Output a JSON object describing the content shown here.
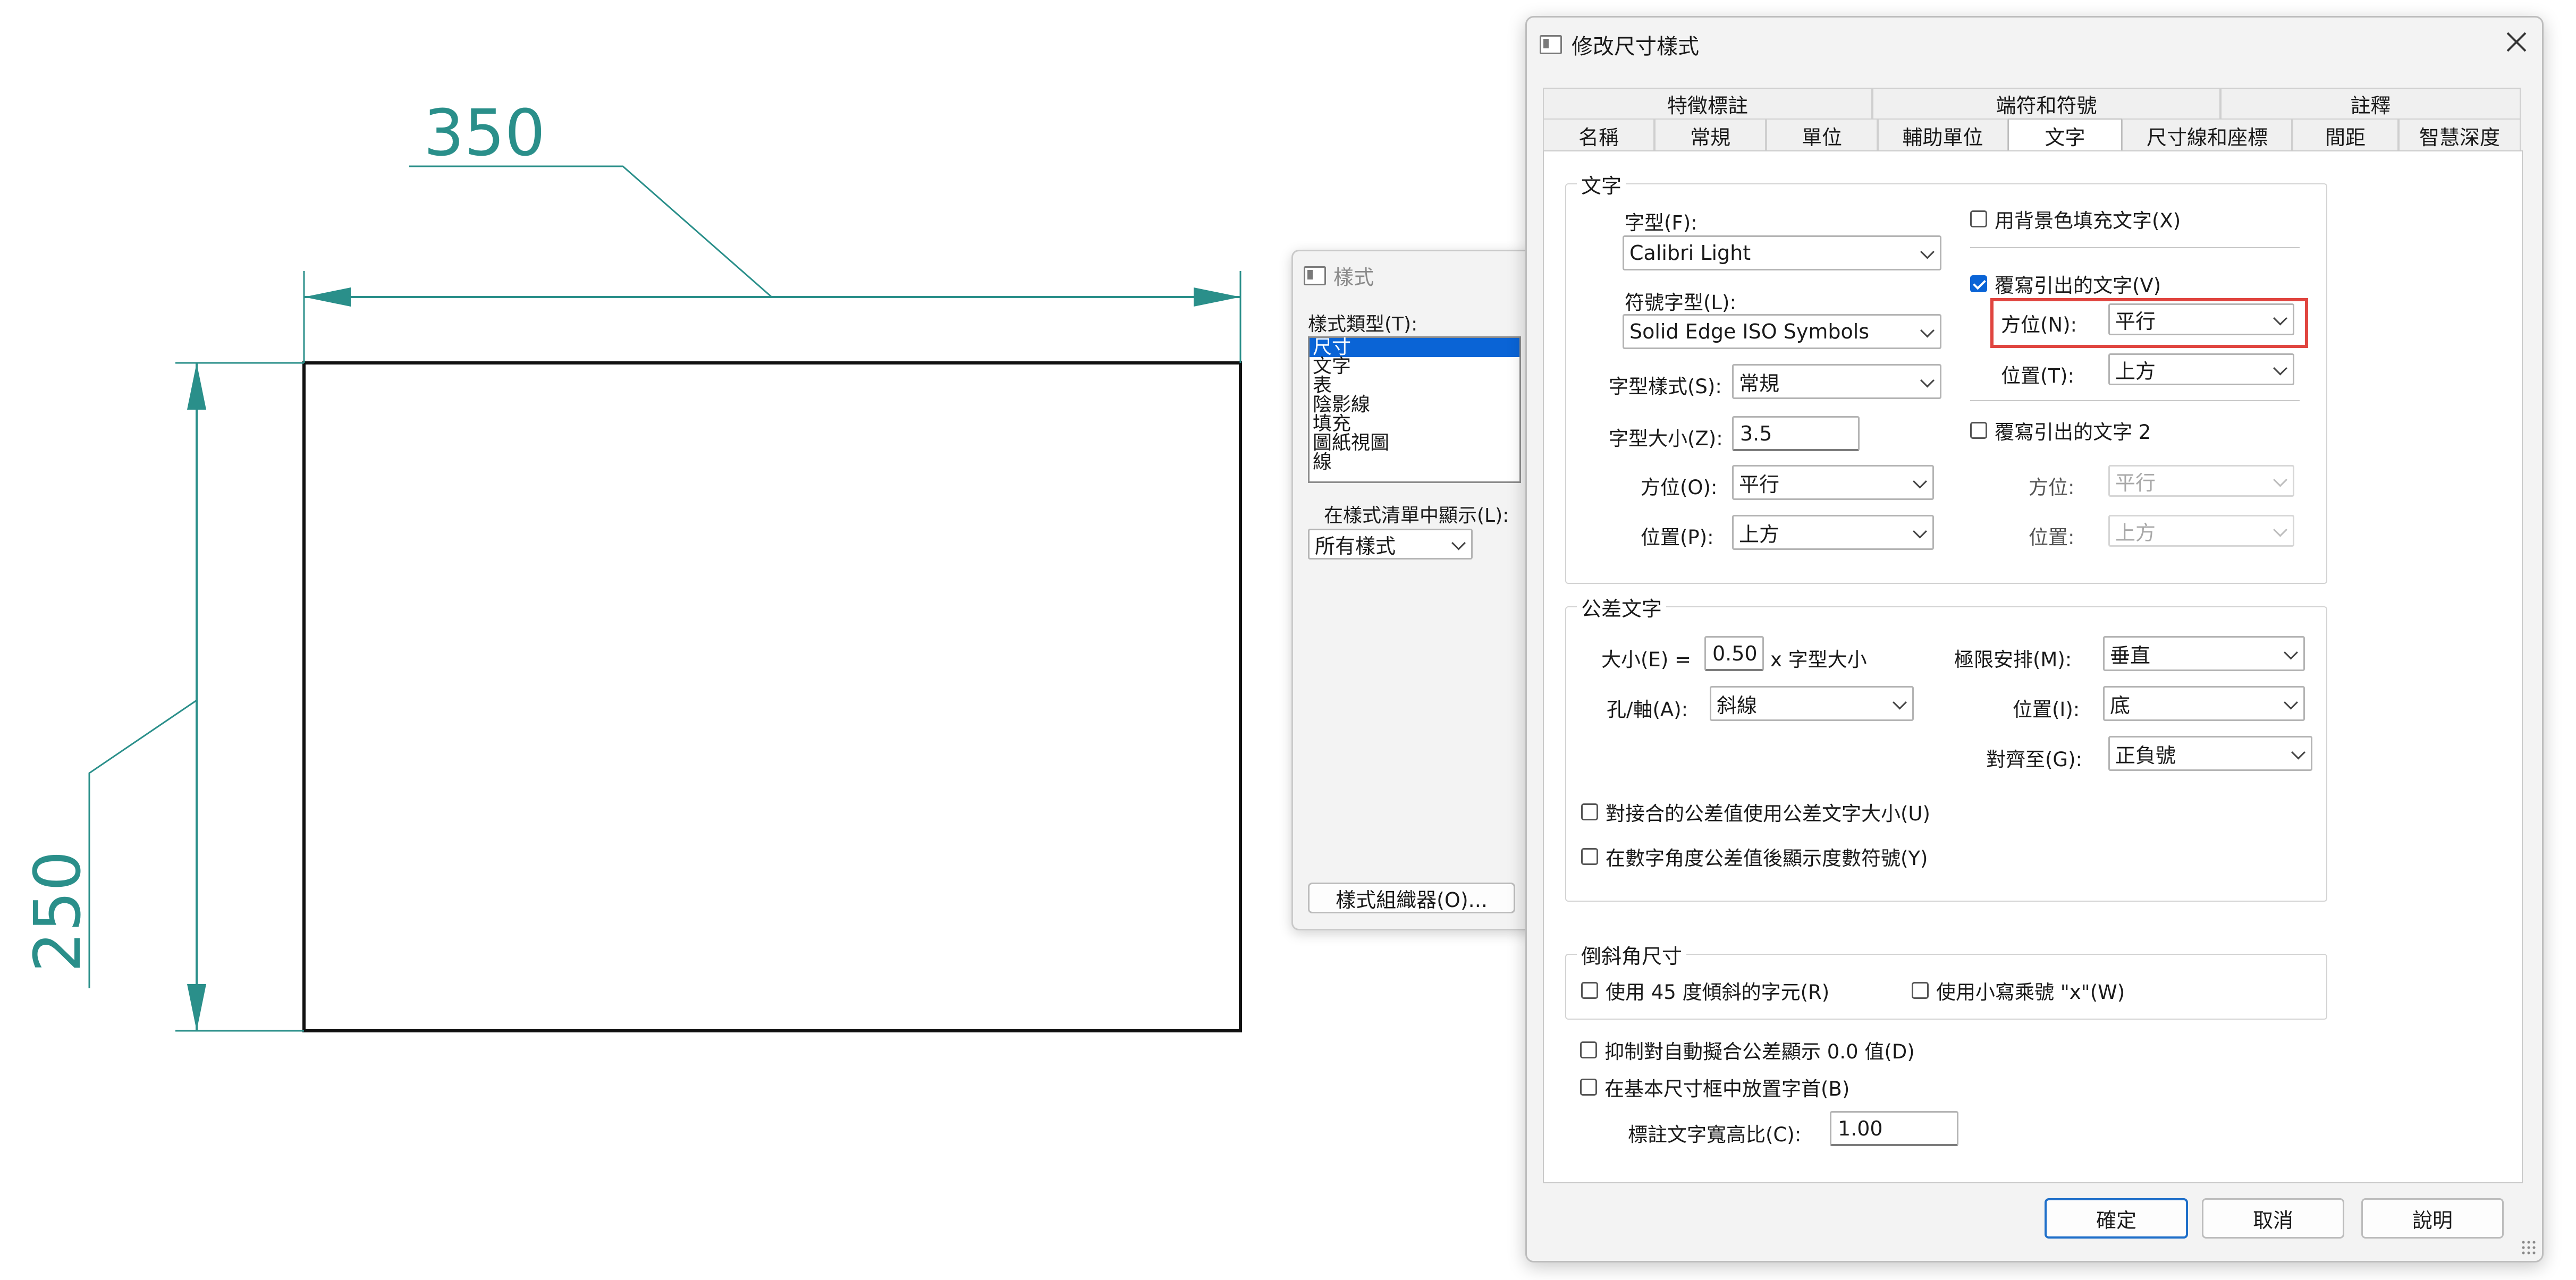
{
  "drawing": {
    "width_dimension": "350",
    "height_dimension": "250",
    "dim_color": "#2a8f8a"
  },
  "styles_panel": {
    "title": "樣式",
    "style_type_label": "樣式類型(T):",
    "style_types": [
      "尺寸",
      "文字",
      "表",
      "陰影線",
      "填充",
      "圖紙視圖",
      "線"
    ],
    "selected_style_type": "尺寸",
    "show_in_list_label": "在樣式清單中顯示(L):",
    "show_in_list_value": "所有樣式",
    "organizer_button": "樣式組織器(O)..."
  },
  "dialog": {
    "title": "修改尺寸樣式",
    "tabs_top": [
      "特徵標註",
      "端符和符號",
      "註釋"
    ],
    "tabs_bottom": [
      "名稱",
      "常規",
      "單位",
      "輔助單位",
      "文字",
      "尺寸線和座標",
      "間距",
      "智慧深度"
    ],
    "active_tab": "文字",
    "text_group": {
      "title": "文字",
      "font_label": "字型(F):",
      "font_value": "Calibri Light",
      "symbol_font_label": "符號字型(L):",
      "symbol_font_value": "Solid Edge ISO Symbols",
      "font_style_label": "字型樣式(S):",
      "font_style_value": "常規",
      "font_size_label": "字型大小(Z):",
      "font_size_value": "3.5",
      "orientation_label": "方位(O):",
      "orientation_value": "平行",
      "position_label": "位置(P):",
      "position_value": "上方",
      "fill_bg_label": "用背景色填充文字(X)",
      "fill_bg_checked": false,
      "override_leader_label": "覆寫引出的文字(V)",
      "override_leader_checked": true,
      "leader_orientation_label": "方位(N):",
      "leader_orientation_value": "平行",
      "leader_position_label": "位置(T):",
      "leader_position_value": "上方",
      "override_leader2_label": "覆寫引出的文字 2",
      "override_leader2_checked": false,
      "leader2_orientation_label": "方位:",
      "leader2_orientation_value": "平行",
      "leader2_position_label": "位置:",
      "leader2_position_value": "上方"
    },
    "tolerance_group": {
      "title": "公差文字",
      "size_label": "大小(E) =",
      "size_value": "0.50",
      "size_suffix": "x 字型大小",
      "hole_shaft_label": "孔/軸(A):",
      "hole_shaft_value": "斜線",
      "limit_label": "極限安排(M):",
      "limit_value": "垂直",
      "position_label": "位置(I):",
      "position_value": "底",
      "align_label": "對齊至(G):",
      "align_value": "正負號",
      "fit_tol_label": "對接合的公差值使用公差文字大小(U)",
      "degree_symbol_label": "在數字角度公差值後顯示度數符號(Y)"
    },
    "chamfer_group": {
      "title": "倒斜角尺寸",
      "use45_label": "使用 45 度傾斜的字元(R)",
      "lowercase_x_label": "使用小寫乘號 \"x\"(W)"
    },
    "suppress_label": "抑制對自動擬合公差顯示 0.0 值(D)",
    "basic_box_label": "在基本尺寸框中放置字首(B)",
    "aspect_ratio_label": "標註文字寬高比(C):",
    "aspect_ratio_value": "1.00",
    "ok_button": "確定",
    "cancel_button": "取消",
    "help_button": "說明",
    "highlight_color": "#e0453f"
  }
}
